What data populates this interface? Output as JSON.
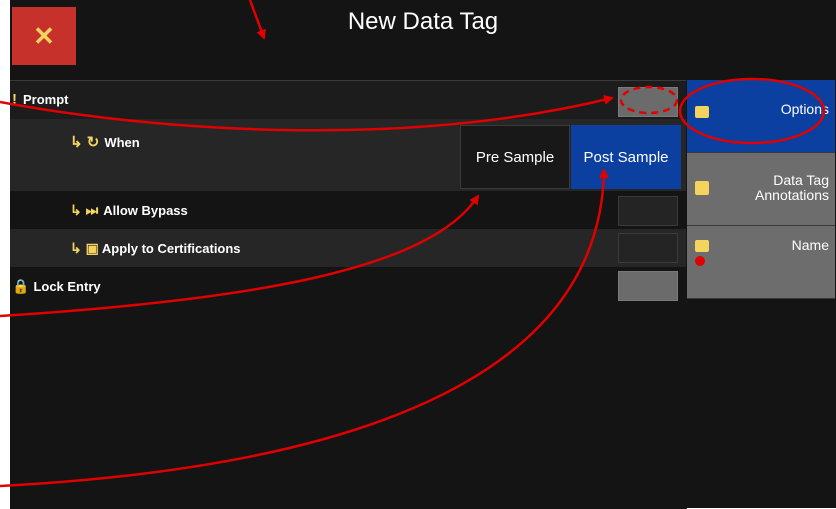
{
  "header": {
    "title": "New Data Tag",
    "close_glyph": "✕"
  },
  "rows": {
    "prompt": {
      "icon": "!",
      "label": "Prompt"
    },
    "when": {
      "icon": "↳ ↻",
      "label": "When"
    },
    "allow_bypass": {
      "icon": "↳ ⏭",
      "label": "Allow Bypass"
    },
    "apply_certifications": {
      "icon": "↳ ▣",
      "label": "Apply to Certifications"
    },
    "lock_entry": {
      "icon": "🔒",
      "label": "Lock Entry"
    }
  },
  "when_options": {
    "pre_sample": "Pre Sample",
    "post_sample": "Post Sample",
    "selected": "Post Sample"
  },
  "sidebar": {
    "items": [
      {
        "label": "Options",
        "active": true,
        "icon": "note-icon"
      },
      {
        "label": "Data Tag\nAnnotations",
        "active": false,
        "icon": "annotation-icon"
      },
      {
        "label": "Name",
        "active": false,
        "icon": "tag-icon"
      }
    ]
  },
  "colors": {
    "background": "#141414",
    "accent_blue": "#0b3fa0",
    "close_red": "#c7312b",
    "icon_yellow": "#f4d35e",
    "annotation_red": "#e00000"
  }
}
